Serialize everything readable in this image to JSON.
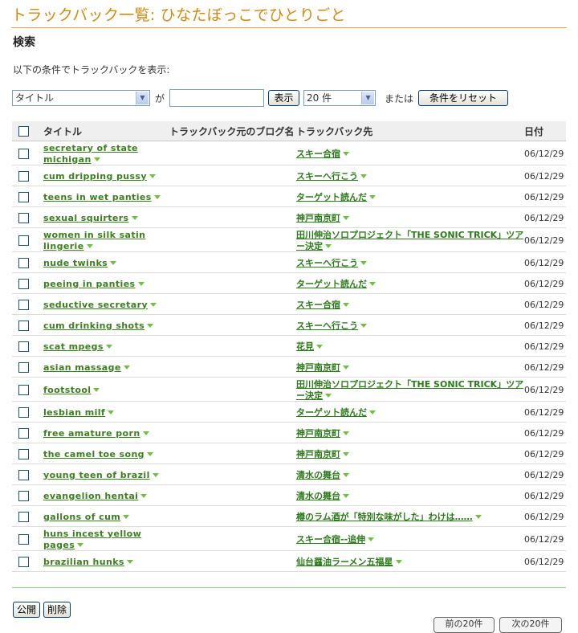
{
  "page_title": "トラックバック一覧: ひなたぼっこでひとりごと",
  "search": {
    "heading": "検索",
    "description": "以下の条件でトラックバックを表示:",
    "field_select": "タイトル",
    "ga_label": "が",
    "keyword_value": "",
    "show_button": "表示",
    "count_select": "20 件",
    "or_label": "または",
    "reset_button": "条件をリセット"
  },
  "table": {
    "headers": {
      "title": "タイトル",
      "blog": "トラックバック元のブログ名",
      "target": "トラックバック先",
      "date": "日付"
    },
    "rows": [
      {
        "title": "secretary of state michigan",
        "target": "スキー合宿",
        "date": "06/12/29"
      },
      {
        "title": "cum dripping pussy",
        "target": "スキーへ行こう",
        "date": "06/12/29"
      },
      {
        "title": "teens in wet panties",
        "target": "ターゲット読んだ",
        "date": "06/12/29"
      },
      {
        "title": "sexual squirters",
        "target": "神戸南京町",
        "date": "06/12/29"
      },
      {
        "title": "women in silk satin lingerie",
        "target": "田川伸治ソロプロジェクト「THE SONIC TRICK」ツアー決定",
        "date": "06/12/29"
      },
      {
        "title": "nude twinks",
        "target": "スキーへ行こう",
        "date": "06/12/29"
      },
      {
        "title": "peeing in panties",
        "target": "ターゲット読んだ",
        "date": "06/12/29"
      },
      {
        "title": "seductive secretary",
        "target": "スキー合宿",
        "date": "06/12/29"
      },
      {
        "title": "cum drinking shots",
        "target": "スキーへ行こう",
        "date": "06/12/29"
      },
      {
        "title": "scat mpegs",
        "target": "花見",
        "date": "06/12/29"
      },
      {
        "title": "asian massage",
        "target": "神戸南京町",
        "date": "06/12/29"
      },
      {
        "title": "footstool",
        "target": "田川伸治ソロプロジェクト「THE SONIC TRICK」ツアー決定",
        "date": "06/12/29"
      },
      {
        "title": "lesbian milf",
        "target": "ターゲット読んだ",
        "date": "06/12/29"
      },
      {
        "title": "free amature porn",
        "target": "神戸南京町",
        "date": "06/12/29"
      },
      {
        "title": "the camel toe song",
        "target": "神戸南京町",
        "date": "06/12/29"
      },
      {
        "title": "young teen of brazil",
        "target": "清水の舞台",
        "date": "06/12/29"
      },
      {
        "title": "evangelion hentai",
        "target": "清水の舞台",
        "date": "06/12/29"
      },
      {
        "title": "gallons of cum",
        "target": "樽のラム酒が「特別な味がした」わけは……",
        "date": "06/12/29"
      },
      {
        "title": "huns incest yellow pages",
        "target": "スキー合宿--追伸",
        "date": "06/12/29"
      },
      {
        "title": "brazilian hunks",
        "target": "仙台醤油ラーメン五福星",
        "date": "06/12/29"
      }
    ]
  },
  "actions": {
    "publish": "公開",
    "delete": "削除"
  },
  "pager": {
    "prev": "前の20件",
    "next": "次の20件"
  }
}
